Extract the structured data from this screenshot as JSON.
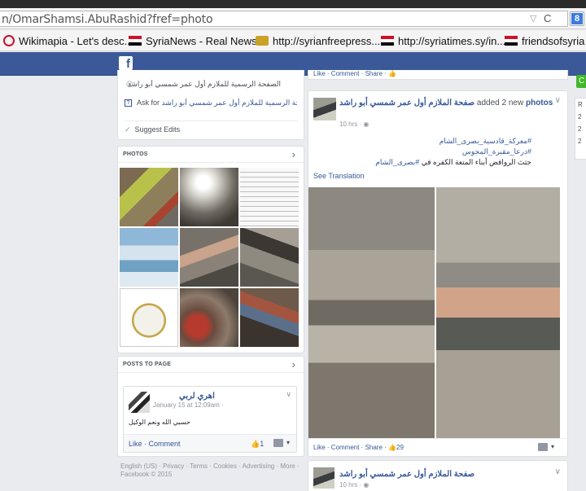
{
  "browser": {
    "url": "n/OmarShamsi.AbuRashid?fref=photo",
    "search_engine_letter": "8",
    "bookmarks": [
      {
        "label": "Wikimapia - Let's desc...",
        "icon": "wikimapia-icon"
      },
      {
        "label": "SyriaNews - Real News...",
        "icon": "syria-flag-icon"
      },
      {
        "label": "http://syrianfreepress....",
        "icon": "emblem-icon"
      },
      {
        "label": "http://syriatimes.sy/in...",
        "icon": "syria-flag-icon"
      },
      {
        "label": "friendsofsyria |",
        "icon": "syria-flag-icon"
      }
    ]
  },
  "facebook": {
    "logo_letter": "f",
    "brand_color": "#3b5998",
    "link_color": "#365899"
  },
  "about": {
    "page_title_ar": "الصفحة الرسمية للملازم أول عمر شمسي أبو راشد",
    "website_prefix": "Ask for",
    "website_link": "صفحة الرسمية للملازم أول عمر شمسي أبو راشد's website",
    "suggest_edits": "Suggest Edits"
  },
  "photos_section": {
    "title": "PHOTOS",
    "arrow": "›"
  },
  "posts_to_page": {
    "title": "POSTS TO PAGE",
    "arrow": "›",
    "post": {
      "author": "اهري لربي",
      "date": "January 15 at 12:09am · ",
      "message": "حسبي الله ونعم الوكيل",
      "actions": "Like · Comment",
      "like_count": "1"
    }
  },
  "footer": {
    "links": "English (US) · Privacy · Terms · Cookies · Advertising · More · Facebook © 2015"
  },
  "previous_post": {
    "footer_actions": "Like · Comment · Share · "
  },
  "main_post": {
    "page_name": "صفحة الملازم أول عمر شمسي أبو راشد",
    "added_text": " added 2 new ",
    "photos_link": "photos",
    "time": "10 hrs · ",
    "hashtag1": "#معركة_قادسية_بصرى_الشام",
    "hashtag2": "#درعا_مقبرة_المجوس",
    "body_text": "جثث الروافض أبناء المتعة الكفره في",
    "hashtag3": "#بصرى_الشام",
    "see_translation": "See Translation",
    "footer_actions": "Like · Comment · Share · ",
    "like_count": "29"
  },
  "next_post": {
    "page_name": "صفحة الملازم أول عمر شمسي أبو راشد",
    "time": "10 hrs · "
  },
  "right_column": {
    "button_letter": "C",
    "items": [
      "R",
      "2",
      "2",
      "2"
    ]
  }
}
